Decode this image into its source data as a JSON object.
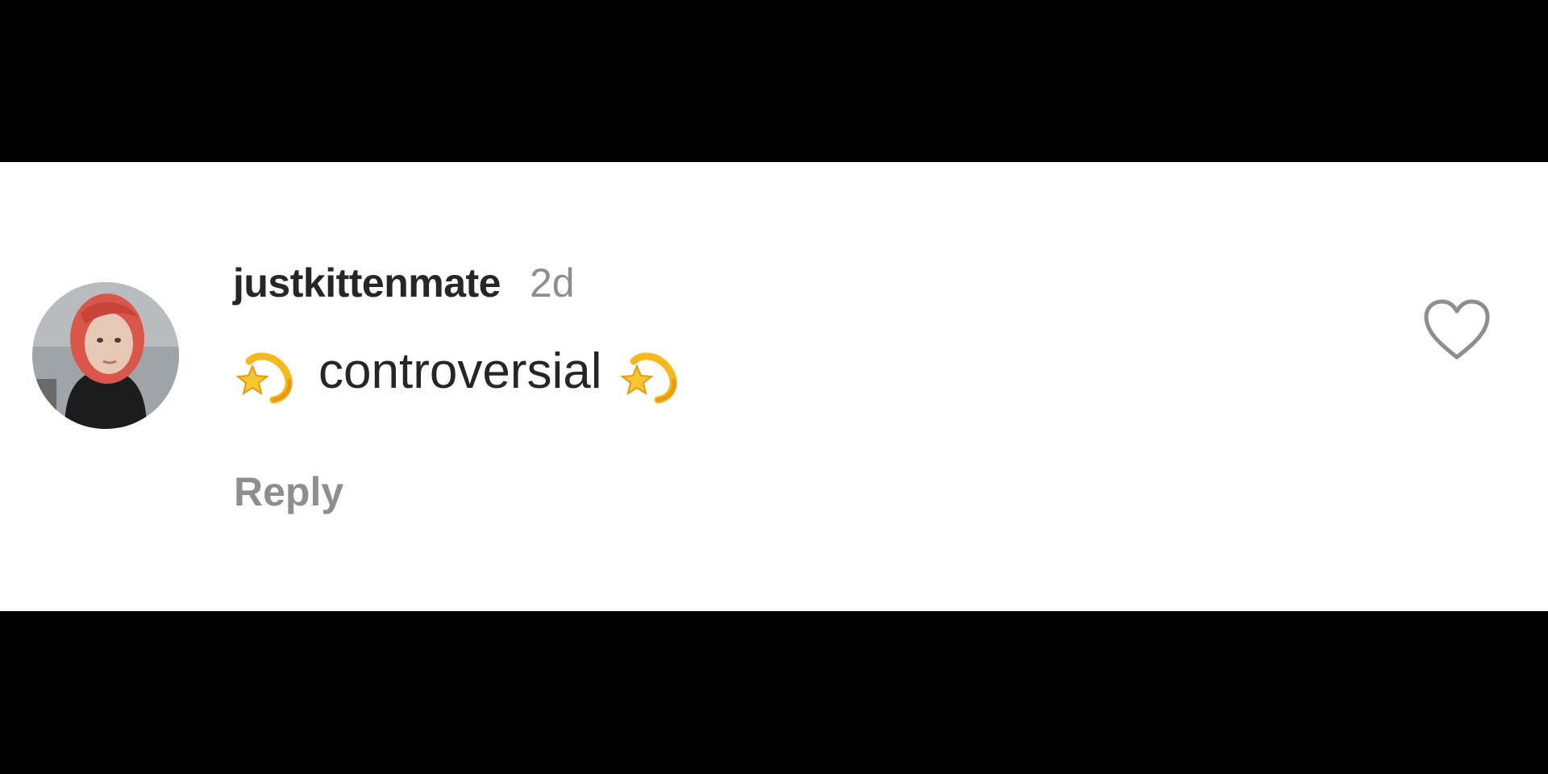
{
  "comment": {
    "username": "justkittenmate",
    "timestamp": "2d",
    "text": "controversial",
    "leading_emoji": "dizzy-emoji",
    "trailing_emoji": "dizzy-emoji",
    "reply_label": "Reply",
    "liked": false
  },
  "icons": {
    "like": "heart-outline-icon",
    "avatar": "user-avatar"
  },
  "colors": {
    "username": "#262626",
    "secondary_text": "#8e8e8e",
    "panel_background": "#ffffff",
    "letterbox": "#000000",
    "emoji_gold": "#f5b91d"
  }
}
